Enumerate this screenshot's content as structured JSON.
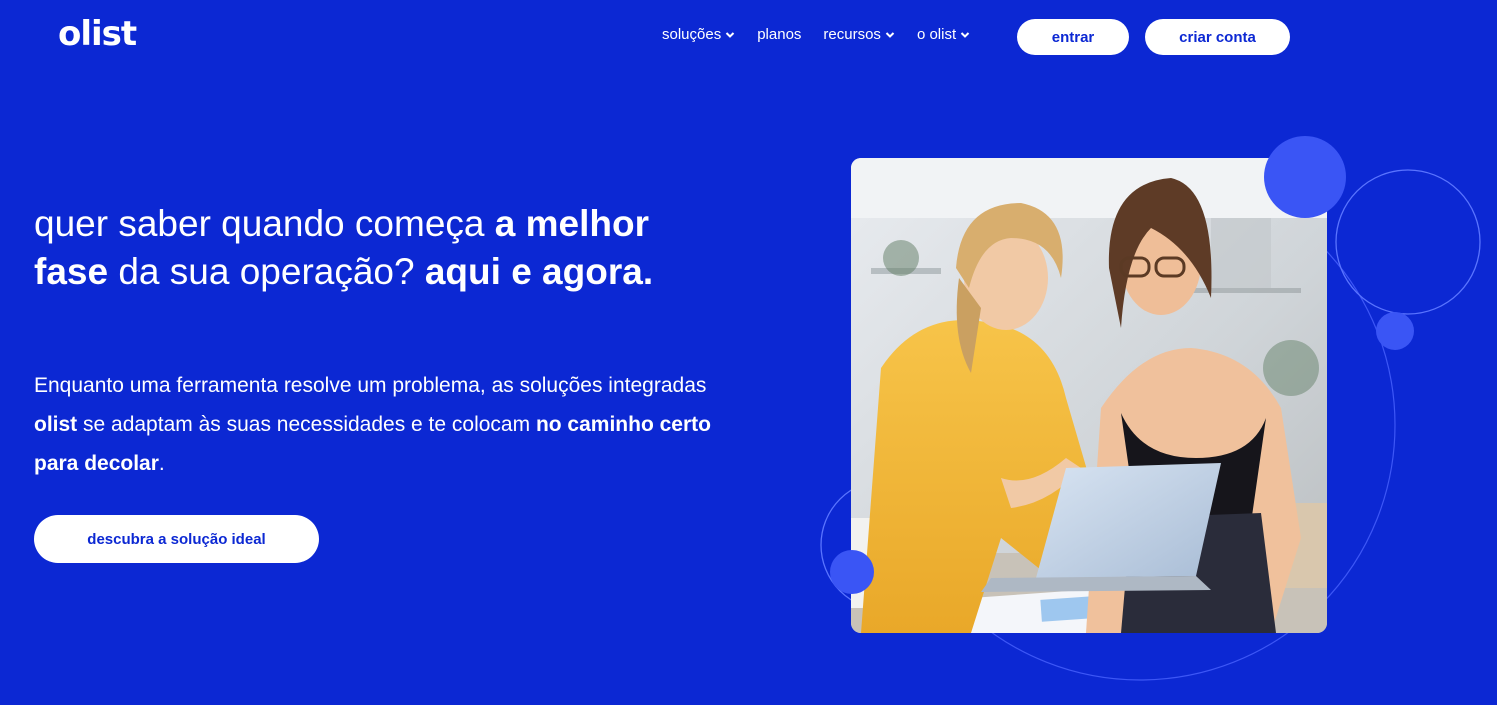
{
  "header": {
    "logo": "olist",
    "nav": [
      {
        "label": "soluções",
        "has_dropdown": true
      },
      {
        "label": "planos",
        "has_dropdown": false
      },
      {
        "label": "recursos",
        "has_dropdown": true
      },
      {
        "label": "o olist",
        "has_dropdown": true
      }
    ],
    "login_label": "entrar",
    "signup_label": "criar conta"
  },
  "hero": {
    "headline": {
      "p1": "quer saber quando começa ",
      "b1": "a melhor fase",
      "p2": " da sua operação? ",
      "b2": "aqui e agora."
    },
    "subtitle": {
      "p1": "Enquanto uma ferramenta resolve um problema, as soluções integradas ",
      "b1": "olist",
      "p2": " se adaptam às suas necessidades e te colocam ",
      "b2": "no caminho certo para decolar",
      "p3": "."
    },
    "cta_label": "descubra a solução ideal",
    "image_icon": "photo-two-women-laptop"
  },
  "colors": {
    "background": "#0c28d3",
    "accent_circle": "#3a55f5",
    "button_bg": "#ffffff",
    "button_text": "#0c28d3"
  }
}
